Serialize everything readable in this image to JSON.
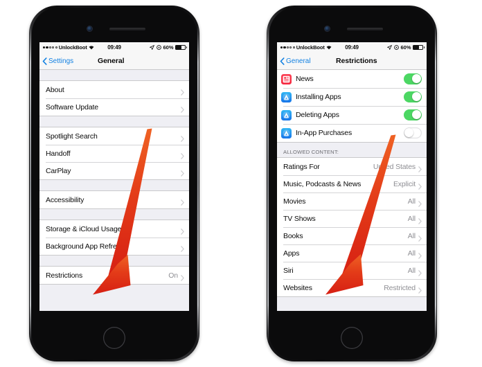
{
  "status_bar": {
    "carrier": "UnlockBoot",
    "signal_dots_filled": 2,
    "signal_dots_total": 5,
    "wifi_icon": "wifi-icon",
    "time": "09:49",
    "location_icon": "location-arrow-icon",
    "rotation_lock_icon": "rotation-lock-icon",
    "battery_percent": "60%",
    "battery_icon": "battery-icon"
  },
  "colors": {
    "ios_blue": "#1281e2",
    "toggle_green": "#4cd763",
    "arrow_red": "#e0301a",
    "list_bg": "#efeff4",
    "secondary_text": "#8e8e93"
  },
  "left_phone": {
    "nav": {
      "back_label": "Settings",
      "back_icon": "chevron-left-icon",
      "title": "General"
    },
    "groups": [
      {
        "rows": [
          {
            "label": "About",
            "value": "",
            "accessory": "chevron-right-icon"
          },
          {
            "label": "Software Update",
            "value": "",
            "accessory": "chevron-right-icon"
          }
        ]
      },
      {
        "rows": [
          {
            "label": "Spotlight Search",
            "value": "",
            "accessory": "chevron-right-icon"
          },
          {
            "label": "Handoff",
            "value": "",
            "accessory": "chevron-right-icon"
          },
          {
            "label": "CarPlay",
            "value": "",
            "accessory": "chevron-right-icon"
          }
        ]
      },
      {
        "rows": [
          {
            "label": "Accessibility",
            "value": "",
            "accessory": "chevron-right-icon"
          }
        ]
      },
      {
        "rows": [
          {
            "label": "Storage & iCloud Usage",
            "value": "",
            "accessory": "chevron-right-icon"
          },
          {
            "label": "Background App Refresh",
            "value": "",
            "accessory": "chevron-right-icon"
          }
        ]
      },
      {
        "rows": [
          {
            "label": "Restrictions",
            "value": "On",
            "accessory": "chevron-right-icon"
          }
        ]
      }
    ]
  },
  "right_phone": {
    "nav": {
      "back_label": "General",
      "back_icon": "chevron-left-icon",
      "title": "Restrictions"
    },
    "toggle_rows": [
      {
        "label": "News",
        "icon": "news-app-icon",
        "state": "on"
      },
      {
        "label": "Installing Apps",
        "icon": "app-store-icon",
        "state": "on"
      },
      {
        "label": "Deleting Apps",
        "icon": "app-store-icon",
        "state": "on"
      },
      {
        "label": "In-App Purchases",
        "icon": "app-store-icon",
        "state": "off"
      }
    ],
    "section_header": "ALLOWED CONTENT:",
    "content_rows": [
      {
        "label": "Ratings For",
        "value": "United States",
        "accessory": "chevron-right-icon"
      },
      {
        "label": "Music, Podcasts & News",
        "value": "Explicit",
        "accessory": "chevron-right-icon"
      },
      {
        "label": "Movies",
        "value": "All",
        "accessory": "chevron-right-icon"
      },
      {
        "label": "TV Shows",
        "value": "All",
        "accessory": "chevron-right-icon"
      },
      {
        "label": "Books",
        "value": "All",
        "accessory": "chevron-right-icon"
      },
      {
        "label": "Apps",
        "value": "All",
        "accessory": "chevron-right-icon"
      },
      {
        "label": "Siri",
        "value": "All",
        "accessory": "chevron-right-icon"
      },
      {
        "label": "Websites",
        "value": "Restricted",
        "accessory": "chevron-right-icon"
      }
    ]
  },
  "annotations": [
    {
      "name": "arrow-to-restrictions",
      "target": "Restrictions"
    },
    {
      "name": "arrow-to-websites",
      "target": "Websites"
    }
  ]
}
